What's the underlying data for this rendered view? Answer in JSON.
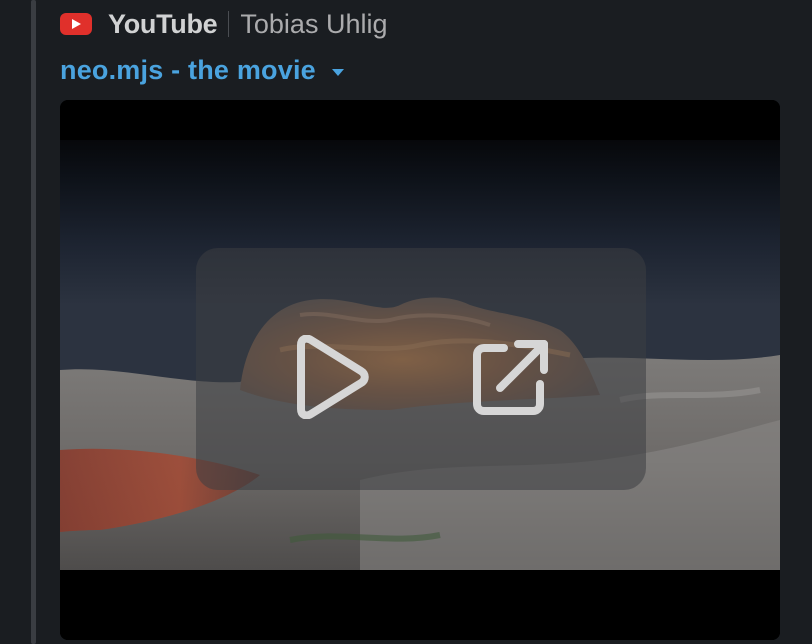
{
  "attachment": {
    "service": {
      "name": "YouTube",
      "brand_color": "#e0302b",
      "icon": "youtube-logo-icon"
    },
    "author": "Tobias Uhlig",
    "title": "neo.mjs - the movie",
    "link_color": "#4aa3df",
    "video": {
      "thumbnail": "desert-rock-landscape-at-dusk",
      "controls": {
        "play_icon": "play-icon",
        "open_icon": "open-external-icon"
      }
    }
  }
}
